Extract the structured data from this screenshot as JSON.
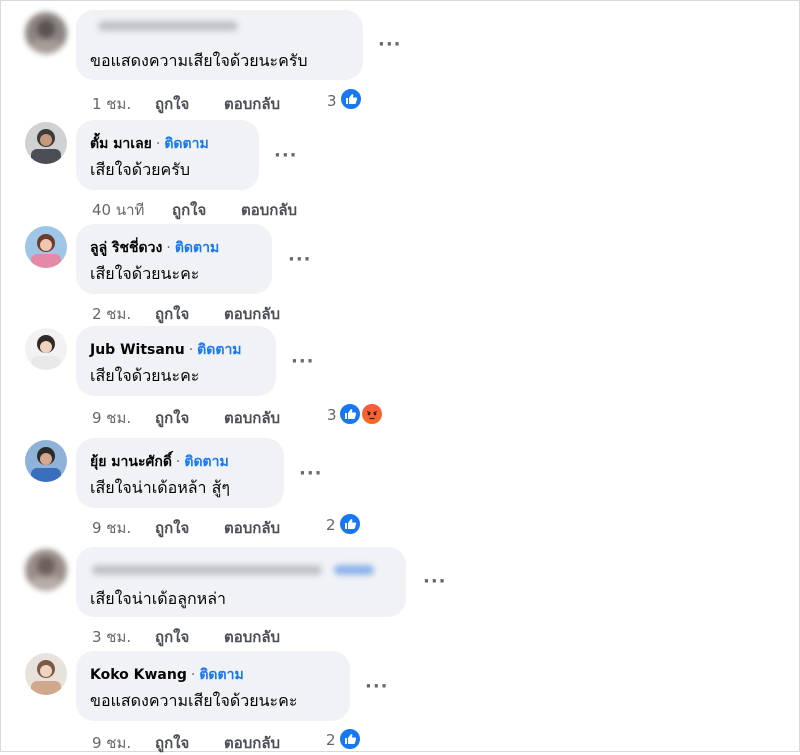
{
  "colors": {
    "bubble_bg": "#f0f2f5",
    "link_blue": "#1877f2",
    "meta_gray": "#65676b",
    "like_blue": "#1877f2",
    "angry_orange": "#f26b28"
  },
  "actions": {
    "like": "ถูกใจ",
    "reply": "ตอบกลับ"
  },
  "follow_label": "ติดตาม",
  "separator": "·",
  "more_label": "···",
  "comments": [
    {
      "name": "",
      "name_blurred": true,
      "text": "ขอแสดงความเสียใจด้วยนะครับ",
      "time": "1 ชม.",
      "reactions": {
        "count": "3",
        "icons": [
          "like-icon"
        ]
      }
    },
    {
      "name": "ตั้ม มาเลย",
      "text": "เสียใจด้วยครับ",
      "time": "40 นาที",
      "reactions": null
    },
    {
      "name": "ลูลู่ ริชชี่ดวง",
      "text": "เสียใจด้วยนะคะ",
      "time": "2 ชม.",
      "reactions": null
    },
    {
      "name": "Jub Witsanu",
      "text": "เสียใจด้วยนะคะ",
      "time": "9 ชม.",
      "reactions": {
        "count": "3",
        "icons": [
          "like-icon",
          "angry-icon"
        ]
      }
    },
    {
      "name": "ยุ้ย มานะศักดิ์",
      "text": "เสียใจน่าเด้อหล้า สู้ๆ",
      "time": "9 ชม.",
      "reactions": {
        "count": "2",
        "icons": [
          "like-icon"
        ]
      }
    },
    {
      "name": "",
      "name_blurred": true,
      "text": "เสียใจน่าเด้อลูกหล่า",
      "time": "3 ชม.",
      "reactions": null
    },
    {
      "name": "Koko Kwang",
      "text": "ขอแสดงความเสียใจด้วยนะคะ",
      "time": "9 ชม.",
      "reactions": {
        "count": "2",
        "icons": [
          "like-icon"
        ]
      }
    }
  ]
}
